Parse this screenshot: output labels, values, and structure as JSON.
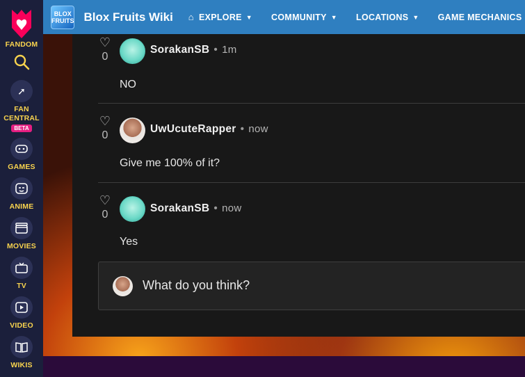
{
  "rail": {
    "logo_label": "FANDOM",
    "items": [
      {
        "label": "FAN",
        "label2": "CENTRAL",
        "badge": "BETA",
        "icon": "rocket-icon"
      },
      {
        "label": "GAMES",
        "icon": "gamepad-icon"
      },
      {
        "label": "ANIME",
        "icon": "anime-face-icon"
      },
      {
        "label": "MOVIES",
        "icon": "clapperboard-icon"
      },
      {
        "label": "TV",
        "icon": "tv-icon"
      },
      {
        "label": "VIDEO",
        "icon": "play-icon"
      },
      {
        "label": "WIKIS",
        "icon": "book-icon"
      }
    ]
  },
  "header": {
    "wiki_logo_text": "BLOX FRUITS",
    "wiki_name": "Blox Fruits Wiki",
    "nav": [
      "EXPLORE",
      "COMMUNITY",
      "LOCATIONS",
      "GAME MECHANICS"
    ]
  },
  "comments": [
    {
      "author": "SorakanSB",
      "time": "1m",
      "likes": "0",
      "text": "NO"
    },
    {
      "author": "UwUcuteRapper",
      "time": "now",
      "likes": "0",
      "text": "Give me 100% of it?"
    },
    {
      "author": "SorakanSB",
      "time": "now",
      "likes": "0",
      "text": "Yes"
    }
  ],
  "reply": {
    "placeholder": "What do you think?"
  },
  "colors": {
    "rail": "#1b1f3b",
    "accent": "#f8d34e",
    "topbar": "#2f7fc0",
    "panel": "#181818"
  }
}
